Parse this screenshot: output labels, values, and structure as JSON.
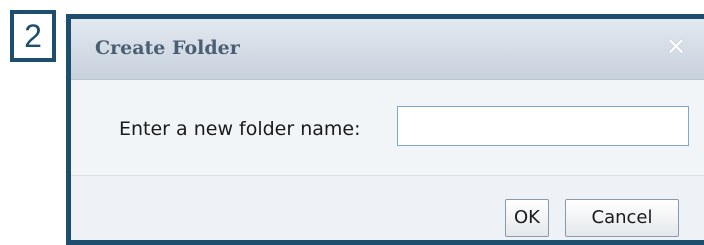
{
  "step": {
    "number": "2"
  },
  "dialog": {
    "title": "Create Folder",
    "close_symbol": "✕",
    "prompt_label": "Enter a new folder name:",
    "folder_name_value": "",
    "ok_label": "OK",
    "cancel_label": "Cancel"
  },
  "colors": {
    "frame": "#1d4e6e",
    "titlebar_text": "#4a5f73",
    "input_border": "#7fa7c9"
  },
  "icons": {
    "close": "close-icon"
  }
}
